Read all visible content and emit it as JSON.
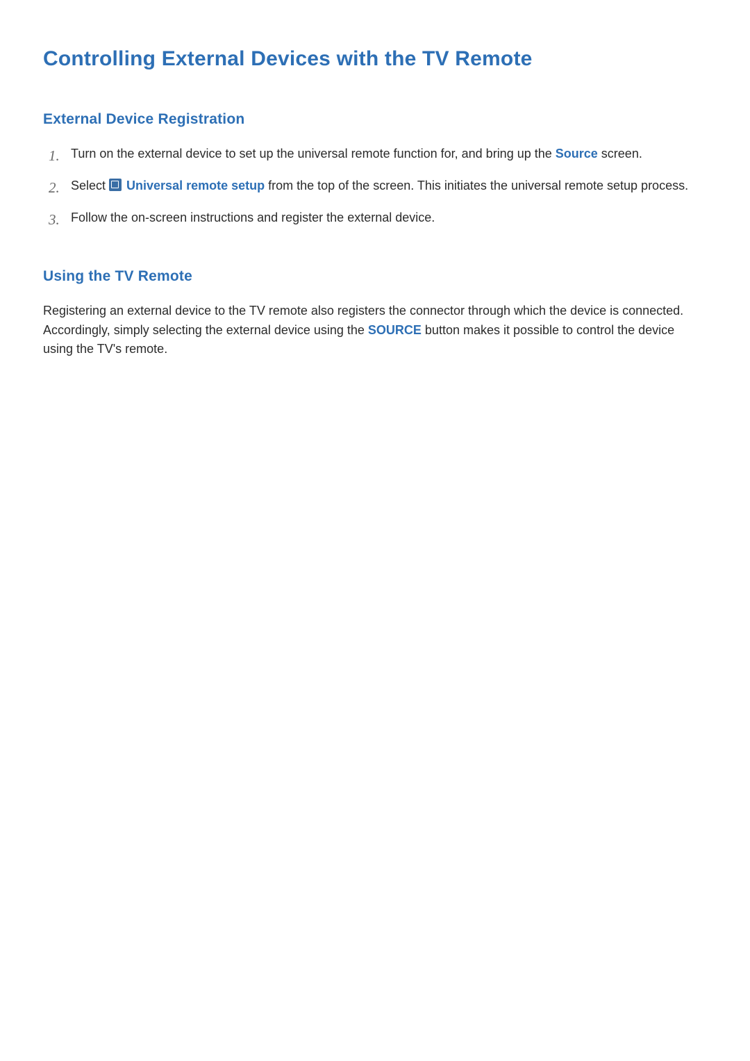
{
  "page_title": "Controlling External Devices with the TV Remote",
  "section1": {
    "heading": "External Device Registration",
    "steps": [
      {
        "pre": "Turn on the external device to set up the universal remote function for, and bring up the ",
        "link": "Source",
        "post": " screen."
      },
      {
        "pre": "Select ",
        "icon": "remote-setup-icon",
        "link": " Universal remote setup",
        "post": " from the top of the screen. This initiates the universal remote setup process."
      },
      {
        "pre": "Follow the on-screen instructions and register the external device.",
        "link": "",
        "post": ""
      }
    ]
  },
  "section2": {
    "heading": "Using the TV Remote",
    "paragraph": {
      "pre": "Registering an external device to the TV remote also registers the connector through which the device is connected. Accordingly, simply selecting the external device using the ",
      "link": "SOURCE",
      "post": " button makes it possible to control the device using the TV's remote."
    }
  }
}
